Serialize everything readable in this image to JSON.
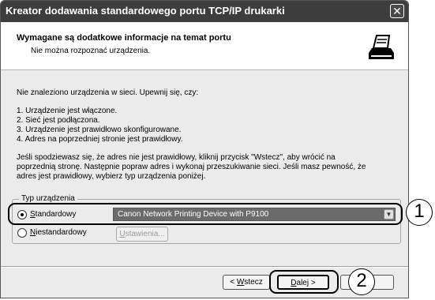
{
  "window": {
    "title": "Kreator dodawania standardowego portu TCP/IP drukarki",
    "close_glyph": "✕"
  },
  "header": {
    "title": "Wymagane są dodatkowe informacje na temat portu",
    "subtitle": "Nie można rozpoznać urządzenia.",
    "icon": "printer-icon"
  },
  "body": {
    "intro": "Nie znaleziono urządzenia w sieci. Upewnij się, czy:",
    "checklist": [
      "1. Urządzenie jest włączone.",
      "2. Sieć jest podłączona.",
      "3. Urządzenie jest prawidłowo skonfigurowane.",
      "4. Adres na poprzedniej stronie jest prawidłowy."
    ],
    "paragraph": [
      "Jeśli spodziewasz się, że adres nie jest prawidłowy, kliknij przycisk \"Wstecz\", aby wrócić na",
      "poprzednią stronę. Następnie popraw adres i wykonaj przeszukiwanie sieci. Jeśli masz pewność, że",
      "adres jest prawidłowy, wybierz typ urządzenia poniżej."
    ]
  },
  "device_type": {
    "legend": "Typ urządzenia",
    "standard": {
      "underlined_char": "S",
      "rest": "tandardowy",
      "selected": true
    },
    "custom": {
      "underlined_char": "N",
      "rest": "iestandardowy",
      "selected": false
    },
    "combo_value": "Canon Network Printing Device with P9100",
    "settings_button": {
      "underlined_char": "U",
      "rest": "stawienia..."
    }
  },
  "buttons": {
    "back": {
      "prefix": "< ",
      "underlined_char": "W",
      "rest": "stecz"
    },
    "next": {
      "underlined_char": "D",
      "rest": "alej >"
    }
  },
  "callouts": {
    "one": "1",
    "two": "2"
  }
}
